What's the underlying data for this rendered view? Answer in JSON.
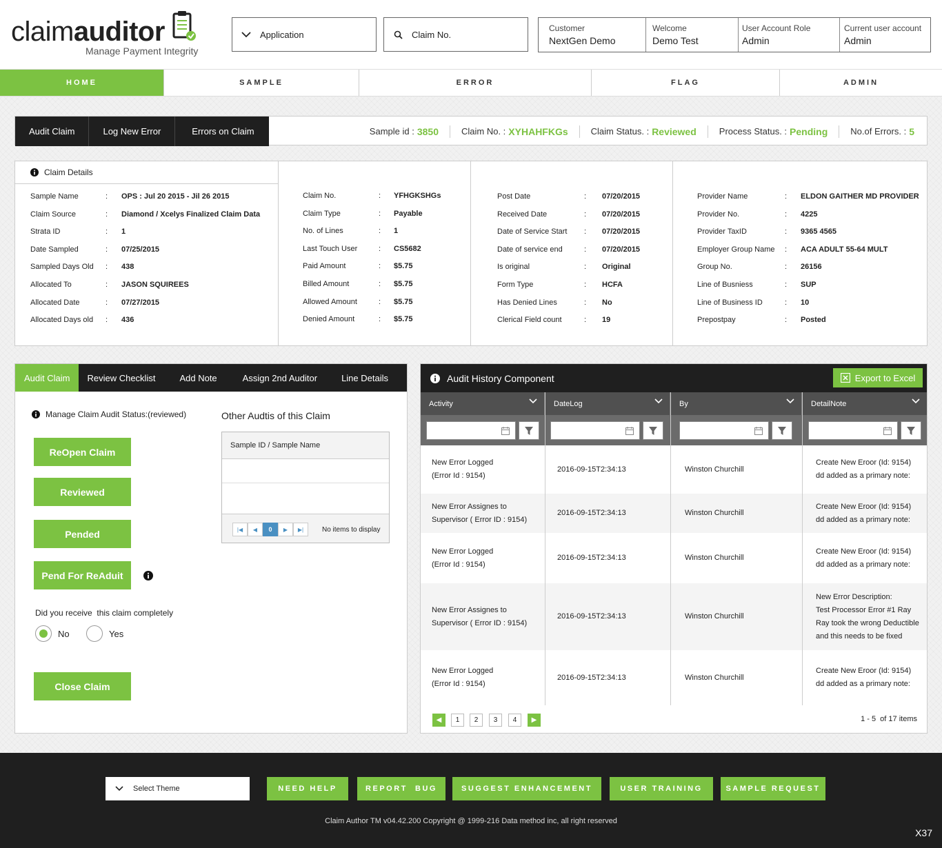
{
  "logo": {
    "part1": "claim",
    "part2": "auditor",
    "tagline": "Manage Payment Integrity"
  },
  "header": {
    "application": "Application",
    "claim_search_placeholder": "Claim No.",
    "user_info": [
      {
        "label": "Customer",
        "value": "NextGen Demo"
      },
      {
        "label": "Welcome",
        "value": "Demo Test"
      },
      {
        "label": "User Account Role",
        "value": "Admin"
      },
      {
        "label": "Current user account",
        "value": "Admin"
      }
    ]
  },
  "nav": [
    "HOME",
    "SAMPLE",
    "ERROR",
    "FLAG",
    "ADMIN"
  ],
  "status_tabs": [
    "Audit Claim",
    "Log New Error",
    "Errors on Claim"
  ],
  "status": {
    "sample_id_label": "Sample id :",
    "sample_id": "3850",
    "claim_no_label": "Claim No. :",
    "claim_no": "XYHAHFKGs",
    "claim_status_label": "Claim Status. :",
    "claim_status": "Reviewed",
    "process_status_label": "Process Status. :",
    "process_status": "Pending",
    "errors_label": "No.of Errors. :",
    "errors": "5"
  },
  "claim_details": {
    "title": "Claim Details",
    "col1": [
      {
        "k": "Sample Name",
        "v": "OPS : Jul 20 2015 - Jil 26 2015"
      },
      {
        "k": "Claim Source",
        "v": "Diamond / Xcelys Finalized Claim Data"
      },
      {
        "k": "Strata ID",
        "v": "1"
      },
      {
        "k": "Date Sampled",
        "v": "07/25/2015"
      },
      {
        "k": "Sampled Days Old",
        "v": "438"
      },
      {
        "k": "Allocated To",
        "v": "JASON SQUIREES"
      },
      {
        "k": "Allocated Date",
        "v": "07/27/2015"
      },
      {
        "k": "Allocated Days old",
        "v": "436"
      }
    ],
    "col2": [
      {
        "k": "Claim No.",
        "v": "YFHGKSHGs"
      },
      {
        "k": "Claim Type",
        "v": "Payable"
      },
      {
        "k": "No. of Lines",
        "v": "1"
      },
      {
        "k": "Last Touch User",
        "v": "CS5682"
      },
      {
        "k": "Paid Amount",
        "v": "$5.75"
      },
      {
        "k": "Billed Amount",
        "v": "$5.75"
      },
      {
        "k": "Allowed Amount",
        "v": "$5.75"
      },
      {
        "k": "Denied Amount",
        "v": "$5.75"
      }
    ],
    "col3": [
      {
        "k": "Post Date",
        "v": "07/20/2015"
      },
      {
        "k": "Received Date",
        "v": "07/20/2015"
      },
      {
        "k": "Date of Service Start",
        "v": "07/20/2015"
      },
      {
        "k": "Date of service end",
        "v": "07/20/2015"
      },
      {
        "k": "Is original",
        "v": "Original"
      },
      {
        "k": "Form Type",
        "v": "HCFA"
      },
      {
        "k": "Has Denied Lines",
        "v": "No"
      },
      {
        "k": "Clerical Field count",
        "v": "19"
      }
    ],
    "col4": [
      {
        "k": "Provider Name",
        "v": "ELDON GAITHER MD PROVIDER"
      },
      {
        "k": "Provider No.",
        "v": "4225"
      },
      {
        "k": "Provider TaxID",
        "v": "9365 4565"
      },
      {
        "k": "Employer Group Name",
        "v": "ACA ADULT 55-64 MULT"
      },
      {
        "k": "Group No.",
        "v": "26156"
      },
      {
        "k": "Line of Busniess",
        "v": "SUP"
      },
      {
        "k": "Line of Business ID",
        "v": "10"
      },
      {
        "k": "Prepostpay",
        "v": "Posted"
      }
    ]
  },
  "audit_tabs": [
    "Audit Claim",
    "Review Checklist",
    "Add Note",
    "Assign 2nd Auditor",
    "Line Details"
  ],
  "audit": {
    "manage_status": "Manage Claim Audit Status:(reviewed)",
    "buttons": [
      "ReOpen Claim",
      "Reviewed",
      "Pended",
      "Pend For ReAduit"
    ],
    "question": "Did you receive  this claim completely",
    "radio_no": "No",
    "radio_yes": "Yes",
    "close_button": "Close Claim",
    "other_title": "Other Audtis of this Claim",
    "other_header": "Sample ID /  Sample Name",
    "pager_page": "0",
    "pager_empty": "No items to display"
  },
  "history": {
    "title": "Audit History Component",
    "export": "Export to Excel",
    "columns": [
      "Activity",
      "DateLog",
      "By",
      "DetailNote"
    ],
    "rows": [
      {
        "activity": [
          "New Error Logged",
          "(Error Id : 9154)"
        ],
        "date": "2016-09-15T2:34:13",
        "by": "Winston Churchill",
        "note": [
          "Create New Eroor (Id: 9154)",
          "dd added as a primary note:"
        ]
      },
      {
        "activity": [
          "New Error Assignes to",
          "Supervisor ( Error ID : 9154)"
        ],
        "date": "2016-09-15T2:34:13",
        "by": "Winston Churchill",
        "note": [
          "Create New Eroor (Id: 9154)",
          "dd added as a primary note:"
        ]
      },
      {
        "activity": [
          "New Error Logged",
          "(Error Id : 9154)"
        ],
        "date": "2016-09-15T2:34:13",
        "by": "Winston Churchill",
        "note": [
          "Create New Eroor (Id: 9154)",
          "dd added as a primary note:"
        ]
      },
      {
        "activity": [
          "New Error Assignes to",
          "Supervisor ( Error ID : 9154)"
        ],
        "date": "2016-09-15T2:34:13",
        "by": "Winston Churchill",
        "note": [
          "New Error Description:",
          "Test Processor Error #1 Ray",
          "Ray took the wrong Deductible",
          "and this needs to be fixed"
        ]
      },
      {
        "activity": [
          "New Error Logged",
          "(Error Id : 9154)"
        ],
        "date": "2016-09-15T2:34:13",
        "by": "Winston Churchill",
        "note": [
          "Create New Eroor (Id: 9154)",
          "dd added as a primary note:"
        ]
      }
    ],
    "pages": [
      "1",
      "2",
      "3",
      "4"
    ],
    "summary": "1 - 5  of 17 items"
  },
  "footer": {
    "theme": "Select Theme",
    "buttons": [
      "NEED HELP",
      "REPORT  BUG",
      "SUGGEST ENHANCEMENT",
      "USER TRAINING",
      "SAMPLE REQUEST"
    ],
    "copyright": "Claim Author TM v04.42.200 Copyright @ 1999-216 Data method inc, all right reserved",
    "version": "X37"
  },
  "colors": {
    "accent": "#7cc242",
    "dark": "#1f1f1f"
  }
}
